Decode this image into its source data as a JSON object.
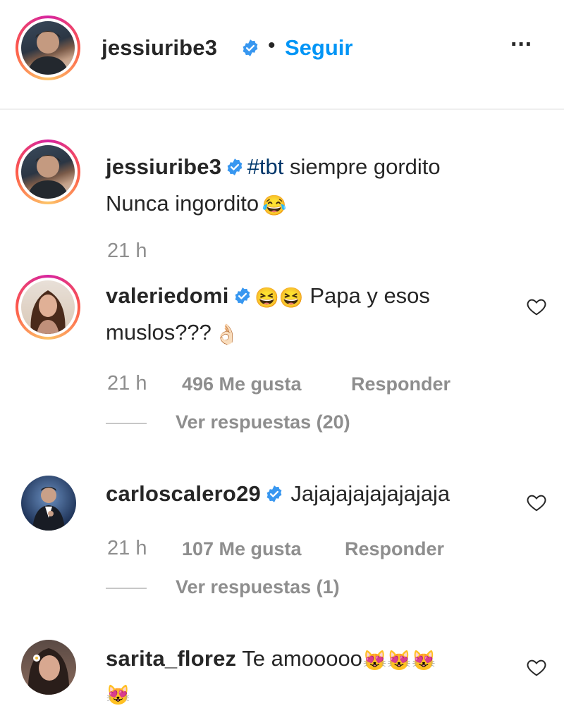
{
  "header": {
    "username": "jessiuribe3",
    "dot": "•",
    "follow_label": "Seguir",
    "more_label": "···"
  },
  "caption": {
    "username": "jessiuribe3",
    "hashtag": "#tbt",
    "text_line1": " siempre gordito",
    "text_line2": "Nunca ingordito",
    "emoji": "😂",
    "time": "21 h"
  },
  "comments": [
    {
      "username": "valeriedomi",
      "emoji_prefix": "😆😆",
      "text_line1": " Papa y esos",
      "text_line2": "muslos???",
      "emoji_suffix": "👌🏻",
      "time": "21 h",
      "likes": "496 Me gusta",
      "reply": "Responder",
      "view_replies": "Ver respuestas (20)"
    },
    {
      "username": "carloscalero29",
      "text_line1": "Jajajajajajajajaja",
      "time": "21 h",
      "likes": "107 Me gusta",
      "reply": "Responder",
      "view_replies": "Ver respuestas (1)"
    },
    {
      "username": "sarita_florez",
      "text_line1": " Te amooooo",
      "emoji_suffix": "😻😻😻",
      "emoji_line2": "😻"
    }
  ],
  "colors": {
    "link": "#0095f6",
    "verified": "#3897f0",
    "secondary": "#8e8e8e"
  }
}
